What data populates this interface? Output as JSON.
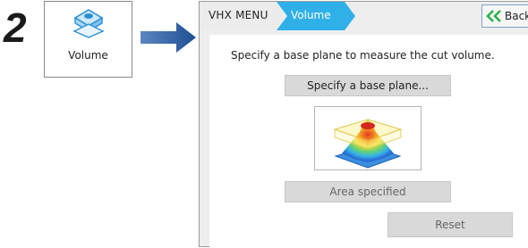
{
  "step": {
    "number": "2"
  },
  "tool_tile": {
    "label": "Volume",
    "icon": "volume-tool-icon"
  },
  "arrow": {
    "icon": "right-arrow-icon",
    "color": "#2f5f9e"
  },
  "breadcrumb": {
    "root": "VHX MENU",
    "current": "Volume",
    "active_color": "#30b0e8"
  },
  "back": {
    "label": "Back",
    "icon": "double-chevron-left-icon",
    "icon_color": "#2db24a"
  },
  "main": {
    "instruction": "Specify a base plane to measure the cut volume.",
    "specify_button": "Specify a base plane...",
    "preview_icon": "volume-3d-preview-icon",
    "area_button": "Area specified",
    "reset_button": "Reset"
  }
}
